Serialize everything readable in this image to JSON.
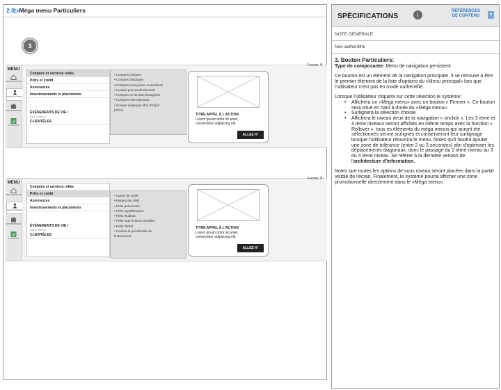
{
  "page": {
    "version": "2.0",
    "title": "Méga menu Particuliers",
    "step_number": "3"
  },
  "mock_menu": {
    "menu_title": "MENU",
    "close_label": "Fermer",
    "close_symbol": "✕",
    "nav_items": [
      {
        "label": "MES COMPTES",
        "icon": "home-icon"
      },
      {
        "label": "PARTICULIERS",
        "icon": "person-icon"
      },
      {
        "label": "ENTREPRISES",
        "icon": "building-icon"
      },
      {
        "label": "À PROPOS",
        "icon": "info-icon"
      }
    ],
    "level1": [
      "Comptes et services reliés",
      "Prêts et crédit",
      "Assurances",
      "Investissements et placements"
    ],
    "level1_secondary": [
      "ÉVÉNEMENTS DE VIE /",
      "CLIENTÈLES"
    ],
    "level1_secondary_sub": "(MENU SIMPLE)",
    "promo": {
      "title": "TITRE APPEL À L'ACTION",
      "text_line1": "Lorem ipsum dolor sit amet,",
      "text_line2": "consectetur adipiscing elit.",
      "button": "ALLEZ-Y!"
    },
    "screen1": {
      "selected_index": 0,
      "level2": [
        "• Comptes chèques",
        "• Comptes d'épargne",
        "• Comptes pour jeunes et étudiants",
        "• Compte pour professionnels",
        "• Comptes en devises étrangères",
        "• Comptes internationaux",
        "• Compte d'épargne libre d'impôt",
        "  (CELI)"
      ]
    },
    "screen2": {
      "selected_index": 1,
      "level2": [
        "• Cartes de crédit",
        "• Marges de crédit",
        "• Prêts personnels",
        "• Prêts hypothécaires",
        "• Prêts étudiant",
        "• Prêts auto et biens durables",
        "• Prêts REER",
        "• Gestion du portefeuille de",
        "  financement"
      ]
    }
  },
  "spec": {
    "title": "SPÉCIFICATIONS",
    "title_icon": "i",
    "ref_line1": "RÉFÉRENCES",
    "ref_line2": "DE CONTENU",
    "note_label": "NOTE GÉNÉRALE",
    "status": "Non authentifié",
    "section_title": "3. Bouton Particuliers:",
    "type_label": "Type de composante:",
    "type_value": "Menu de navigation persistent",
    "p1": "Ce bouton est un élément de la navigation principale. Il se retrouve à être le premier élément de la liste d'options du «Menu principal» lors que l'utilisateur n'est pas en mode authentifié.",
    "p2": "Lorsque l'utilisateur cliquera sur cette sélection le système:",
    "bullets": [
      "Affichera un «Méga menu» avec un bouton « Fermer ». Ce bouton sera situé en haut à droite du «Méga menu».",
      "Surlignera la sélection choisie",
      "Affichera le niveau deux de la navigation « onclick ». Les 3 ième et 4 ième niveaux seront affichés en même temps avec la fonction « Rollover ». tous es éléments du méga menus qui auront été sélectionnés seront surlignés et conserveront leur surlignage lorsque l'utilisateur réouvrira le menu. Notez qu'il faudra ajouter une zone de tolérance (entre 2 ou 3 secondes) afin d'optimiser les déplacements diagonaux, donc le passage du 2 ième niveau au 3 ou 4 ième niveau. Se référer à la dernière version de l'"
    ],
    "bullet_bold_tail": "architecture d'information.",
    "p3": "Notez que toutes les options de sous niveau seront placées dans la partie visible de l'écran. Finalement, le système pourra afficher une zone promotionnelle directement dans le «Méga menu»."
  }
}
